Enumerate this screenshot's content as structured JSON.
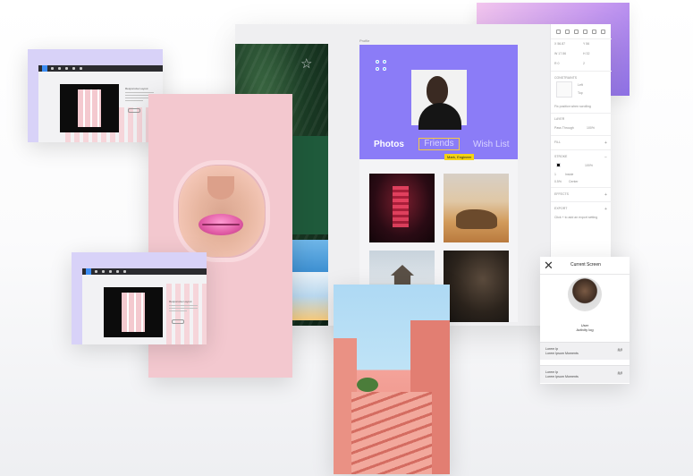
{
  "profile_frame": {
    "label": "Profile",
    "tabs": [
      "Photos",
      "Friends",
      "Wish List"
    ],
    "tooltip": "Mark, Engineer"
  },
  "inspector": {
    "x_label": "X",
    "x_value": "56.87",
    "y_label": "Y",
    "y_value": "56",
    "w_label": "W",
    "w_value": "17.56",
    "h_label": "H",
    "h_value": "32",
    "r_label": "R",
    "r_value": "0",
    "r2_value": "2",
    "constraints_label": "CONSTRAINTS",
    "constraint_h": "Left",
    "constraint_v": "Top",
    "fix_scroll_label": "Fix position when scrolling",
    "layer_label": "LAYER",
    "blend_mode": "Pass Through",
    "layer_opacity": "100%",
    "fill_label": "FILL",
    "stroke_label": "STROKE",
    "stroke_opacity": "100%",
    "stroke_width": "1",
    "stroke_position": "Inside",
    "stroke_weight": "0.5%",
    "stroke_style": "Center",
    "effects_label": "EFFECTS",
    "export_label": "EXPORT",
    "export_hint": "Click + to add an export setting"
  },
  "mini_window": {
    "heading": "Responsive Layout",
    "button": "Button"
  },
  "current_screen": {
    "title": "Current Screen",
    "close_icon": "close-icon",
    "user": "User",
    "activity": "Activity log",
    "items": [
      {
        "line1": "Lorem Ip",
        "line2": "Lorem Ipsum Moments",
        "action": "##"
      },
      {
        "line1": "Lorem Ip",
        "line2": "Lorem Ipsum Moments",
        "action": "##"
      }
    ]
  }
}
